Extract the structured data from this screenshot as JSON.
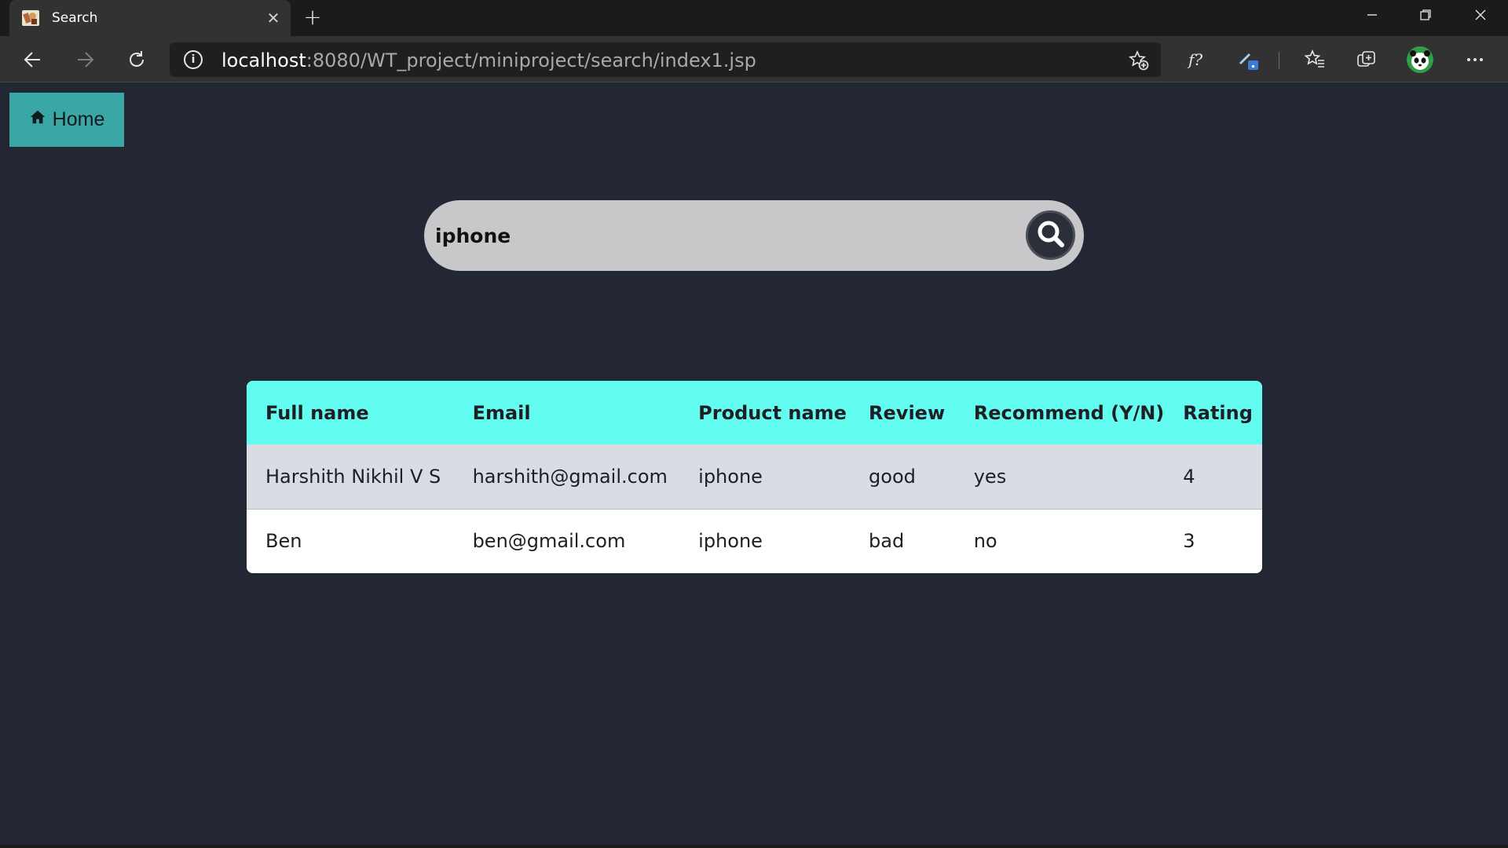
{
  "browser": {
    "tab_title": "Search",
    "new_tab_symbol": "+",
    "url_host": "localhost",
    "url_rest": ":8080/WT_project/miniproject/search/index1.jsp"
  },
  "page": {
    "home_label": "Home",
    "search": {
      "value": "iphone"
    },
    "table": {
      "headers": [
        "Full name",
        "Email",
        "Product name",
        "Review",
        "Recommend (Y/N)",
        "Rating"
      ],
      "rows": [
        [
          "Harshith Nikhil V S",
          "harshith@gmail.com",
          "iphone",
          "good",
          "yes",
          "4"
        ],
        [
          "Ben",
          "ben@gmail.com",
          "iphone",
          "bad",
          "no",
          "3"
        ]
      ]
    }
  },
  "colors": {
    "page_bg": "#222733",
    "home_button": "#3aa6a6",
    "table_header": "#62fdf0",
    "search_box": "#c8c8cb"
  },
  "icons": {
    "home": "home-icon",
    "search": "search-icon",
    "back": "back-arrow-icon",
    "forward": "forward-arrow-icon",
    "refresh": "refresh-icon",
    "info": "info-icon",
    "add_favorite": "add-favorite-icon",
    "formula": "formula-icon",
    "extension": "extension-icon",
    "favorites": "favorites-icon",
    "collections": "collections-icon",
    "profile": "profile-avatar-icon",
    "menu": "more-menu-icon"
  }
}
